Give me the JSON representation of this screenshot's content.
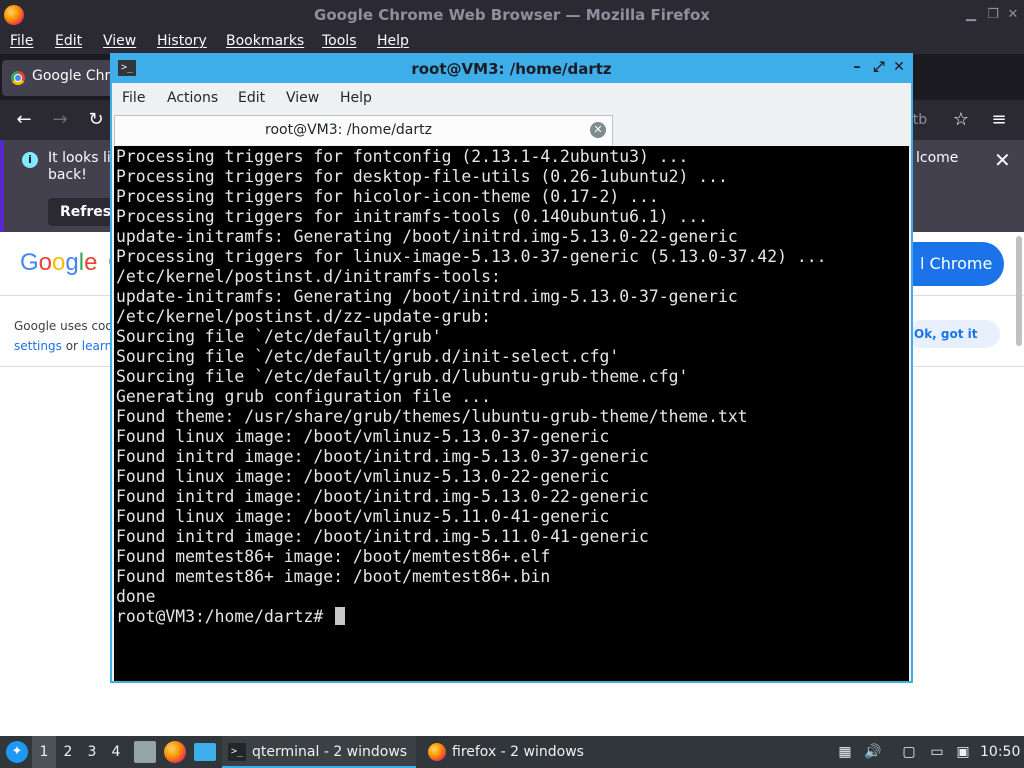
{
  "firefox": {
    "window_title": "Google Chrome Web Browser — Mozilla Firefox",
    "menu": [
      "File",
      "Edit",
      "View",
      "History",
      "Bookmarks",
      "Tools",
      "Help"
    ],
    "tab_label": "Google Chro",
    "url_tail": "ultb",
    "notification": {
      "text": "It looks lik back!",
      "refresh_label": "Refresh",
      "tail_text": "lcome"
    }
  },
  "google_page": {
    "logo": [
      "G",
      "o",
      "o",
      "g",
      "l",
      "e"
    ],
    "logo_tail": "C",
    "chrome_button": "l Chrome",
    "cookie_line1": "Google uses cook",
    "cookie_link1": "settings",
    "cookie_or": "or",
    "cookie_link2": "learn m",
    "ok_button": "Ok, got it"
  },
  "terminal": {
    "window_title": "root@VM3: /home/dartz",
    "menu": [
      "File",
      "Actions",
      "Edit",
      "View",
      "Help"
    ],
    "tab_label": "root@VM3: /home/dartz",
    "lines": [
      "Processing triggers for fontconfig (2.13.1-4.2ubuntu3) ...",
      "Processing triggers for desktop-file-utils (0.26-1ubuntu2) ...",
      "Processing triggers for hicolor-icon-theme (0.17-2) ...",
      "Processing triggers for initramfs-tools (0.140ubuntu6.1) ...",
      "update-initramfs: Generating /boot/initrd.img-5.13.0-22-generic",
      "Processing triggers for linux-image-5.13.0-37-generic (5.13.0-37.42) ...",
      "/etc/kernel/postinst.d/initramfs-tools:",
      "update-initramfs: Generating /boot/initrd.img-5.13.0-37-generic",
      "/etc/kernel/postinst.d/zz-update-grub:",
      "Sourcing file `/etc/default/grub'",
      "Sourcing file `/etc/default/grub.d/init-select.cfg'",
      "Sourcing file `/etc/default/grub.d/lubuntu-grub-theme.cfg'",
      "Generating grub configuration file ...",
      "Found theme: /usr/share/grub/themes/lubuntu-grub-theme/theme.txt",
      "Found linux image: /boot/vmlinuz-5.13.0-37-generic",
      "Found initrd image: /boot/initrd.img-5.13.0-37-generic",
      "Found linux image: /boot/vmlinuz-5.13.0-22-generic",
      "Found initrd image: /boot/initrd.img-5.13.0-22-generic",
      "Found linux image: /boot/vmlinuz-5.11.0-41-generic",
      "Found initrd image: /boot/initrd.img-5.11.0-41-generic",
      "Found memtest86+ image: /boot/memtest86+.elf",
      "Found memtest86+ image: /boot/memtest86+.bin",
      "done"
    ],
    "prompt": "root@VM3:/home/dartz# "
  },
  "taskbar": {
    "workspaces": [
      "1",
      "2",
      "3",
      "4"
    ],
    "active_workspace": "1",
    "tasks": [
      {
        "label": "qterminal - 2 windows",
        "icon": "terminal-icon"
      },
      {
        "label": "firefox - 2 windows",
        "icon": "firefox-icon"
      }
    ],
    "clock": "10:50"
  },
  "colors": {
    "accent": "#3daee9",
    "firefox_dark": "#2b2a33",
    "google_blue": "#1a73e8"
  }
}
